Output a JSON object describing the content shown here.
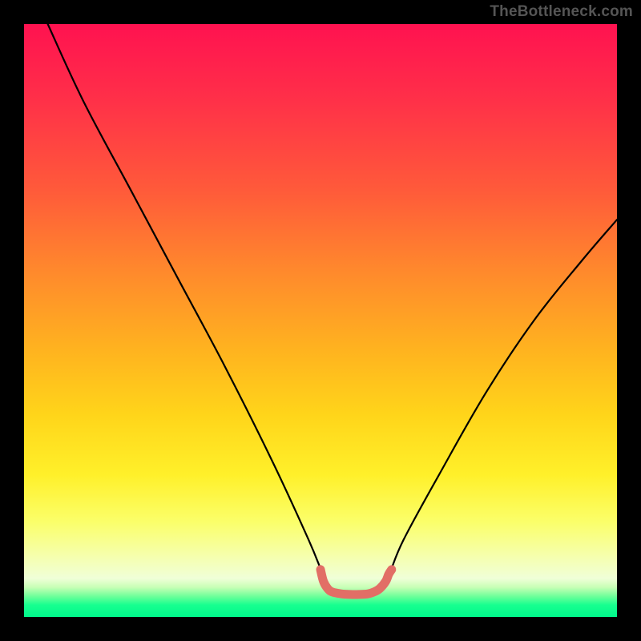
{
  "watermark": "TheBottleneck.com",
  "chart_data": {
    "type": "line",
    "title": "",
    "xlabel": "",
    "ylabel": "",
    "xlim": [
      0,
      100
    ],
    "ylim": [
      0,
      100
    ],
    "grid": false,
    "series": [
      {
        "name": "main-curve",
        "color": "#000000",
        "x": [
          4,
          10,
          18,
          26,
          34,
          42,
          48,
          50.5,
          52,
          55,
          58,
          60,
          61.5,
          64,
          70,
          78,
          86,
          94,
          100
        ],
        "values": [
          100,
          87,
          72,
          57,
          42,
          26,
          13,
          7,
          4.5,
          3.8,
          3.8,
          4.5,
          7,
          13,
          24,
          38,
          50,
          60,
          67
        ]
      },
      {
        "name": "basin-marker",
        "color": "#e26e66",
        "x": [
          50,
          50.5,
          51.2,
          52,
          53.5,
          55,
          56.5,
          58,
          59,
          60,
          61,
          61.5,
          62
        ],
        "values": [
          8.0,
          6.0,
          4.8,
          4.2,
          3.9,
          3.8,
          3.8,
          3.9,
          4.2,
          4.8,
          6.0,
          7.2,
          8.0
        ]
      }
    ],
    "annotations": []
  },
  "colors": {
    "frame": "#000000",
    "curve": "#000000",
    "basin": "#e26e66",
    "watermark": "#555555"
  }
}
